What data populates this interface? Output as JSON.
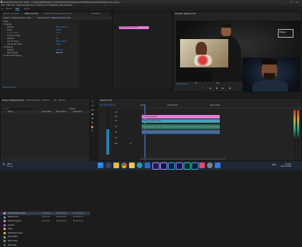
{
  "window": {
    "title": "Adobe Premiere Pro 2024 - C:\\Users\\Editing\\Documents\\Adobe\\Premiere Pro\\Editing Practice\\Project_01.prproj *",
    "min": "–",
    "max": "☐",
    "close": "✕"
  },
  "menu": [
    "File",
    "Edit",
    "Clip",
    "Sequence",
    "Markers",
    "Graphics and Titles",
    "View",
    "Window",
    "Help"
  ],
  "workspaces": [
    "Import",
    "Edit",
    "Export"
  ],
  "source_panel": {
    "tabs": [
      "Source: (no clips)",
      "Effect Controls",
      "Audio Clip Mixer: Sequence 01",
      "Metadata"
    ],
    "header": "Master * Editing Practice.mp4",
    "clip_label": "Sequence 01 * Editing Practice.mp4",
    "rows": [
      {
        "label": "Video",
        "value": ""
      },
      {
        "label": "fx Motion",
        "value": ""
      },
      {
        "label": "Position",
        "value": "960.0   540.0"
      },
      {
        "label": "Scale",
        "value": "100.0"
      },
      {
        "label": "Scale Width",
        "value": "100.0"
      },
      {
        "label": "Uniform Scale",
        "value": "✓"
      },
      {
        "label": "Rotation",
        "value": "0.0"
      },
      {
        "label": "Anchor Point",
        "value": "960.0   540.0"
      },
      {
        "label": "Anti-flicker Filter",
        "value": "0.00"
      },
      {
        "label": "fx Opacity",
        "value": ""
      },
      {
        "label": "Opacity",
        "value": "100.0 %"
      },
      {
        "label": "Blend Mode",
        "value": "Normal"
      },
      {
        "label": "fx Time Remapping",
        "value": ""
      }
    ],
    "clip_chip": "Editing Practice.mp4",
    "timecode": "00:00:00:00"
  },
  "program_panel": {
    "tab": "Program: Sequence 01",
    "timecode": "00:00:00:23",
    "fit": "Fit",
    "quality": "Full",
    "duration": "00:00:10:00",
    "overlay_caption": "Happy"
  },
  "project_panel": {
    "tabs": [
      "Project: Editing Practice",
      "Media Browser",
      "Libraries",
      "Info",
      "Effects"
    ],
    "search_placeholder": "Search",
    "count": "4 items",
    "columns": [
      "Name",
      "Frame Rate",
      "Media Start",
      "Media End"
    ],
    "items": [
      {
        "name": "Editing Practice.mp4",
        "fps": "25.00 fps",
        "start": "00:00:00:00",
        "end": "00:00:09:24"
      },
      {
        "name": "Sequence 01",
        "fps": "25.00 fps",
        "start": "00:00:00:00",
        "end": "00:00:09:24"
      },
      {
        "name": "Flower Bouquet",
        "fps": "25.00 fps",
        "start": "00:00:00:00",
        "end": "00:00:04:24"
      },
      {
        "name": "Portrait",
        "fps": "",
        "start": "",
        "end": ""
      },
      {
        "name": "Titles",
        "fps": "",
        "start": "",
        "end": ""
      },
      {
        "name": "Adjustment Layer",
        "fps": "",
        "start": "",
        "end": ""
      },
      {
        "name": "Color Matte",
        "fps": "",
        "start": "",
        "end": ""
      },
      {
        "name": "Black Video",
        "fps": "",
        "start": "",
        "end": ""
      },
      {
        "name": "Music.wav",
        "fps": "",
        "start": "",
        "end": ""
      }
    ]
  },
  "timeline": {
    "tab": "Sequence 01",
    "timecode": "00:00:00:23",
    "ruler": [
      "00:00",
      "00:00:05:00",
      "00:00:10:00"
    ],
    "tracks": [
      "V3",
      "V2",
      "V1",
      "A1",
      "A2",
      "A3",
      "Mix"
    ],
    "clips": {
      "v2": "Flower Bouquet",
      "v1": "Editing Practice.mp4"
    },
    "mix_value": "0.0"
  },
  "taskbar": {
    "weather_temp": "28°C",
    "weather_text": "Sunny",
    "time": "12:40",
    "date": "25-01-2024",
    "lang": "ENG",
    "icons": [
      "windows-icon",
      "search-icon",
      "files-icon",
      "chrome-icon",
      "folder-icon",
      "edge-icon",
      "store-icon",
      "premiere-icon",
      "aftereffects-icon",
      "photoshop-icon",
      "media-encoder-icon",
      "audition-icon",
      "lightroom-icon",
      "music-icon",
      "settings-icon",
      "mail-icon"
    ]
  },
  "colors": {
    "accent": "#2d8ceb",
    "clip_pink": "#e57fd9",
    "clip_teal": "#49a0b8",
    "audio_green": "#2f6f5e",
    "playhead": "#3d8cf0"
  }
}
